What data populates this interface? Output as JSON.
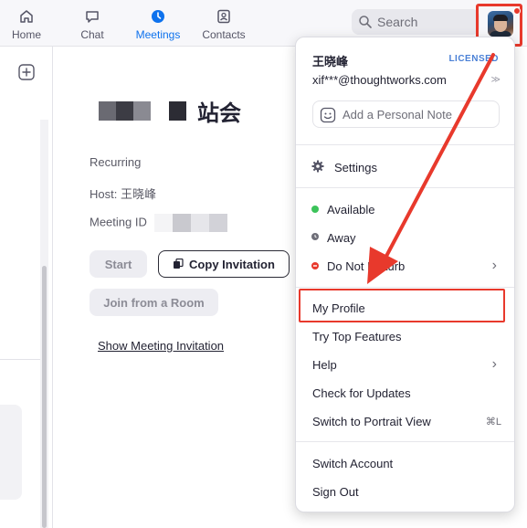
{
  "nav": {
    "tabs": [
      {
        "label": "Home",
        "icon": "home-icon",
        "active": false
      },
      {
        "label": "Chat",
        "icon": "chat-icon",
        "active": false
      },
      {
        "label": "Meetings",
        "icon": "clock-icon",
        "active": true
      },
      {
        "label": "Contacts",
        "icon": "contacts-icon",
        "active": false
      }
    ],
    "search": {
      "placeholder": "Search"
    }
  },
  "meeting": {
    "title": "站会",
    "recurring": "Recurring",
    "host": "Host: 王晓峰",
    "meeting_id_label": "Meeting ID",
    "buttons": {
      "start": "Start",
      "copy_invitation": "Copy Invitation",
      "join_from_room": "Join from a Room"
    },
    "show_invitation": "Show Meeting Invitation"
  },
  "menu": {
    "user_name": "王晓峰",
    "license": "LICENSED",
    "email": "xif***@thoughtworks.com",
    "email_mark": "≫",
    "note_placeholder": "Add a Personal Note",
    "settings": "Settings",
    "statuses": [
      {
        "label": "Available",
        "color": "#3cc35a"
      },
      {
        "label": "Away",
        "color": "#6e6e78"
      },
      {
        "label": "Do Not Disturb",
        "color": "#e8392c"
      }
    ],
    "items": {
      "my_profile": "My Profile",
      "try_top_features": "Try Top Features",
      "help": "Help",
      "check_updates": "Check for Updates",
      "portrait_view": "Switch to Portrait View",
      "portrait_shortcut": "⌘L",
      "switch_account": "Switch Account",
      "sign_out": "Sign Out"
    },
    "chevron": "›"
  },
  "colors": {
    "accent": "#0e72ed",
    "annotation": "#e8392c"
  }
}
